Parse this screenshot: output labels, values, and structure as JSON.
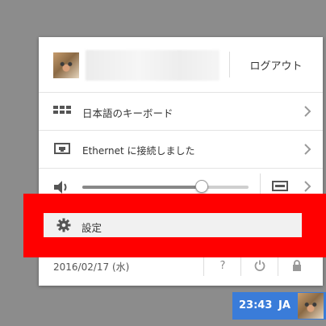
{
  "user": {
    "logout_label": "ログアウト"
  },
  "keyboard": {
    "label": "日本語のキーボード",
    "icon": "keyboard-icon"
  },
  "network": {
    "label": "Ethernet に接続しました",
    "icon": "ethernet-icon"
  },
  "volume": {
    "level": 0.72,
    "icon": "speaker-icon",
    "output_icon": "audio-output-icon"
  },
  "settings": {
    "label": "設定",
    "icon": "gear-icon"
  },
  "footer": {
    "date": "2016/02/17 (水)",
    "help_label": "?",
    "power_icon": "power-icon",
    "lock_icon": "lock-icon"
  },
  "tray": {
    "time": "23:43",
    "ime": "JA"
  },
  "colors": {
    "highlight": "#ff0000",
    "tray": "#3a7cd9"
  }
}
